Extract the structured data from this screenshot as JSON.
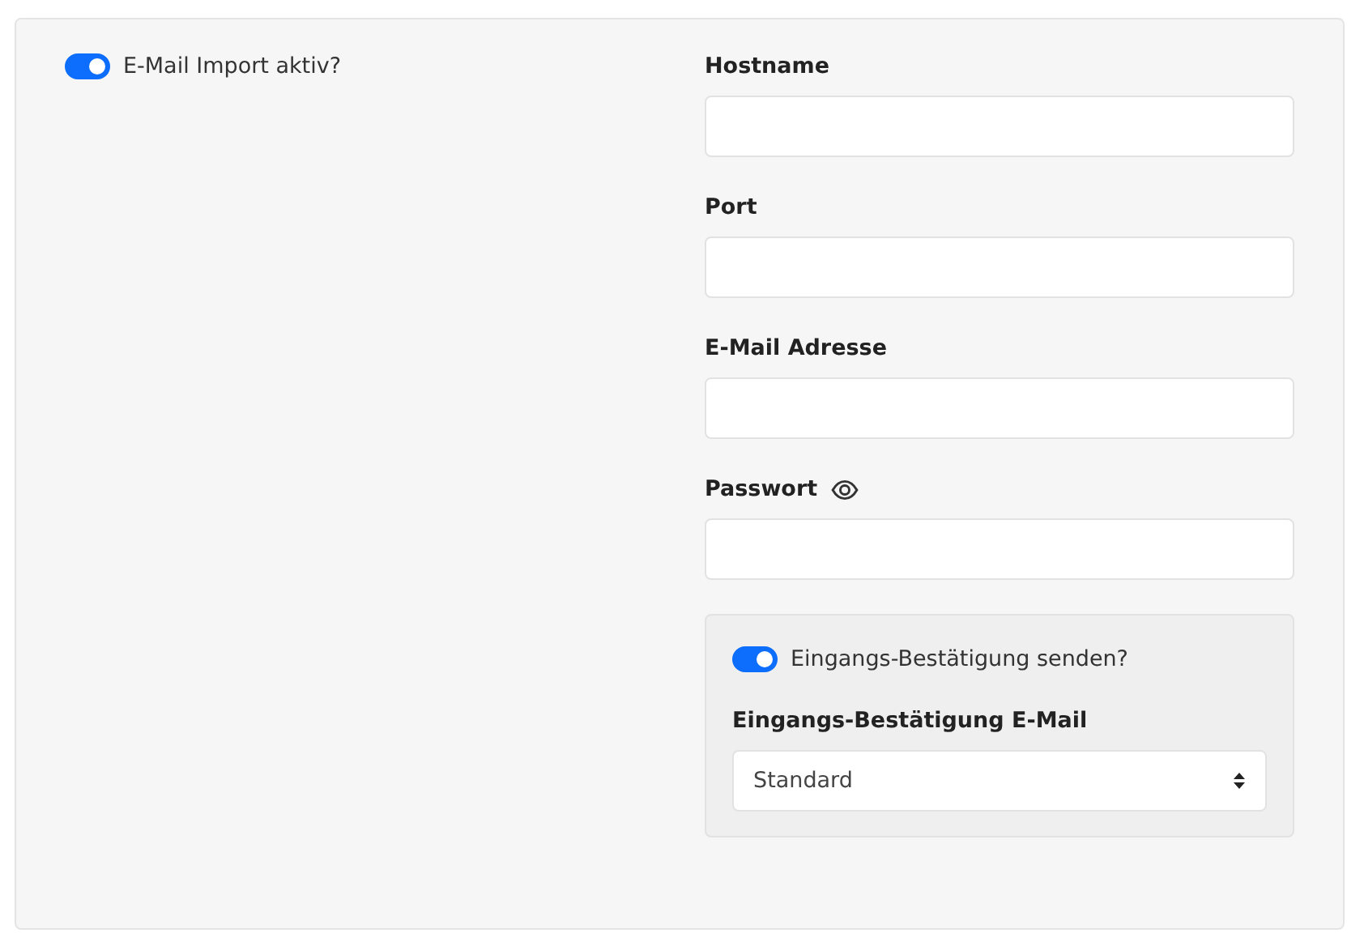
{
  "import_toggle": {
    "label": "E-Mail Import aktiv?",
    "on": true
  },
  "fields": [
    {
      "kind": "text",
      "label": "Hostname"
    },
    {
      "kind": "text",
      "label": "Port"
    },
    {
      "kind": "text",
      "label": "E-Mail Adresse"
    },
    {
      "kind": "password",
      "label": "Passwort"
    }
  ],
  "confirmation": {
    "toggle": {
      "label": "Eingangs-Bestätigung senden?",
      "on": true
    },
    "select": {
      "label": "Eingangs-Bestätigung E-Mail",
      "value": "Standard"
    }
  }
}
